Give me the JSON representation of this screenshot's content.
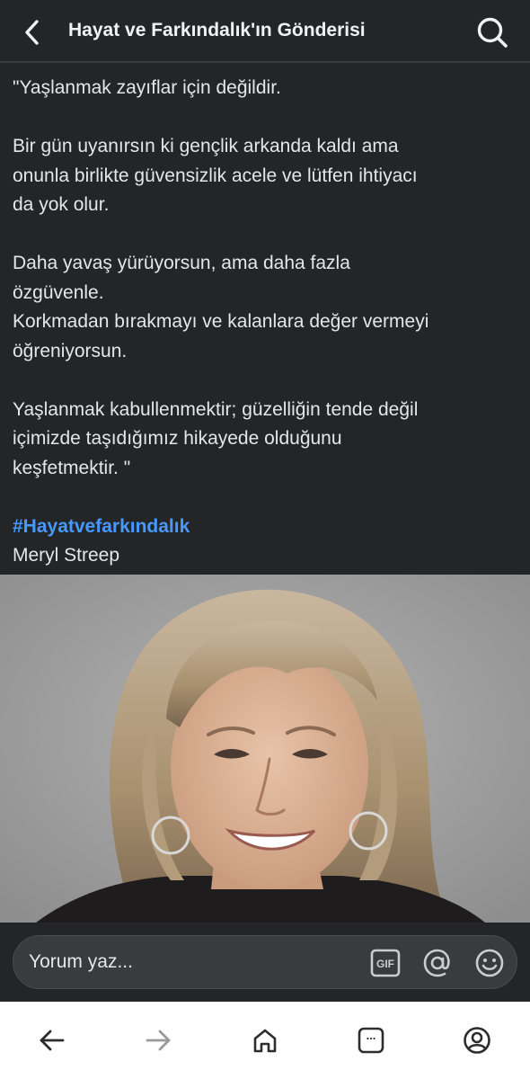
{
  "header": {
    "title": "Hayat ve Farkındalık'ın Gönderisi",
    "back_icon": "chevron-left-icon",
    "search_icon": "search-icon"
  },
  "post": {
    "paragraphs": [
      [
        "\"Yaşlanmak zayıflar için değildir."
      ],
      [
        "Bir gün uyanırsın ki gençlik arkanda kaldı ama",
        "onunla birlikte güvensizlik acele ve lütfen ihtiyacı",
        "da yok olur."
      ],
      [
        "Daha yavaş yürüyorsun, ama daha fazla",
        "özgüvenle.",
        "Korkmadan bırakmayı ve kalanlara değer vermeyi",
        "öğreniyorsun."
      ],
      [
        "Yaşlanmak kabullenmektir; güzelliğin tende değil",
        "içimizde taşıdığımız hikayede olduğunu",
        "keşfetmektir. \""
      ]
    ],
    "hashtag": "#Hayatvefarkındalık",
    "author": "Meryl Streep"
  },
  "comment": {
    "placeholder": "Yorum yaz...",
    "gif_icon": "gif-icon",
    "mention_icon": "at-sign-icon",
    "emoji_icon": "smiley-icon"
  },
  "navbar": {
    "icons": [
      "back-arrow-icon",
      "forward-arrow-icon",
      "home-icon",
      "tabs-icon",
      "profile-icon"
    ],
    "tabs_label": "..."
  },
  "colors": {
    "background": "#242526",
    "text": "#e4e6eb",
    "hashtag": "#4599ff",
    "navbar": "#ffffff"
  }
}
